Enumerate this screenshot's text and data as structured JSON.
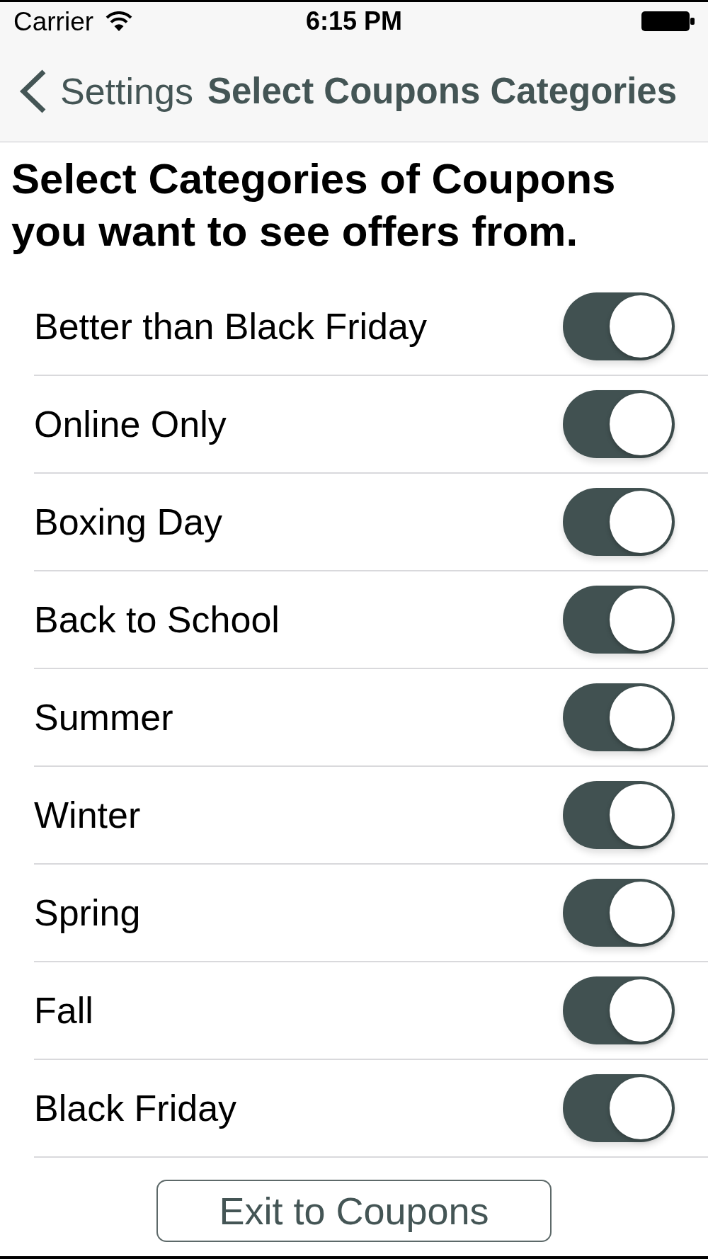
{
  "status_bar": {
    "carrier": "Carrier",
    "time": "6:15 PM"
  },
  "nav_bar": {
    "back_label": "Settings",
    "title": "Select Coupons Categories"
  },
  "heading": "Select Categories of Coupons you want to see offers from.",
  "categories": [
    {
      "label": "Better than Black Friday",
      "on": true
    },
    {
      "label": "Online Only",
      "on": true
    },
    {
      "label": "Boxing Day",
      "on": true
    },
    {
      "label": "Back to School",
      "on": true
    },
    {
      "label": "Summer",
      "on": true
    },
    {
      "label": "Winter",
      "on": true
    },
    {
      "label": "Spring",
      "on": true
    },
    {
      "label": "Fall",
      "on": true
    },
    {
      "label": "Black Friday",
      "on": true
    }
  ],
  "exit_button": "Exit to Coupons"
}
